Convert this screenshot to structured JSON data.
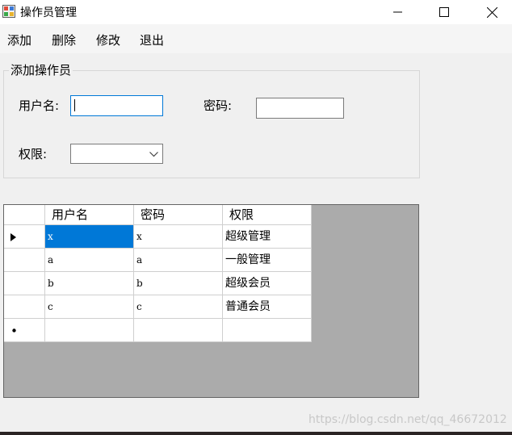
{
  "window": {
    "title": "操作员管理",
    "icon": "app-form-icon",
    "controls": [
      "minimize-icon",
      "maximize-icon",
      "close-icon"
    ]
  },
  "menu": {
    "items": [
      "添加",
      "删除",
      "修改",
      "退出"
    ]
  },
  "group": {
    "title": "添加操作员",
    "username_label": "用户名:",
    "username_value": "",
    "password_label": "密码:",
    "password_value": "",
    "permission_label": "权限:",
    "permission_value": ""
  },
  "grid": {
    "columns": [
      "用户名",
      "密码",
      "权限"
    ],
    "rows": [
      {
        "username": "x",
        "password": "x",
        "permission": "超级管理"
      },
      {
        "username": "a",
        "password": "a",
        "permission": "一般管理"
      },
      {
        "username": "b",
        "password": "b",
        "permission": "超级会员"
      },
      {
        "username": "c",
        "password": "c",
        "permission": "普通会员"
      }
    ],
    "current_row_marker": "▶",
    "new_row_marker": "*"
  },
  "watermark": "https://blog.csdn.net/qq_46672012",
  "colors": {
    "selection": "#0078d7",
    "grid_background": "#ababab",
    "focus_border": "#0078d7"
  }
}
